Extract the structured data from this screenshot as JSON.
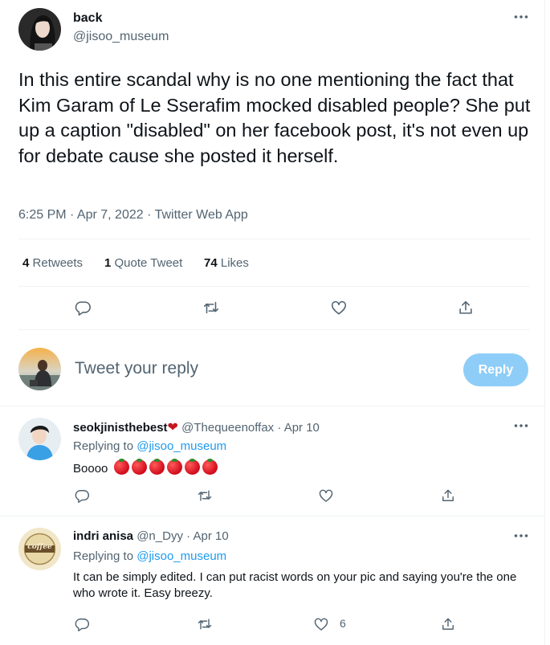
{
  "main_tweet": {
    "display_name": "back",
    "handle": "@jisoo_museum",
    "text": "In this entire scandal why is no one mentioning the fact that Kim Garam of Le Sserafim mocked disabled people? She put up a caption \"disabled\" on her facebook post, it's not even up for debate cause she posted it herself.",
    "timestamp": "6:25 PM · Apr 7, 2022 · Twitter Web App",
    "stats": {
      "retweets_count": "4",
      "retweets_label": "Retweets",
      "quotes_count": "1",
      "quotes_label": "Quote Tweet",
      "likes_count": "74",
      "likes_label": "Likes"
    }
  },
  "reply_box": {
    "placeholder": "Tweet your reply",
    "button_label": "Reply"
  },
  "replies": [
    {
      "display_name": "seokjinisthebest",
      "name_emoji": "❤",
      "handle": "@Thequeenoffax",
      "date": "Apr 10",
      "replying_prefix": "Replying to",
      "replying_handle": "@jisoo_museum",
      "text": "Boooo",
      "emoji_count": 6,
      "like_count": ""
    },
    {
      "display_name": "indri anisa",
      "handle": "@n_Dyy",
      "date": "Apr 10",
      "replying_prefix": "Replying to",
      "replying_handle": "@jisoo_museum",
      "text": "It can be simply edited. I can put racist words on your pic and saying you're the one who wrote it. Easy breezy.",
      "avatar_text": "coffee",
      "like_count": "6"
    }
  ],
  "colors": {
    "accent": "#1d9bf0",
    "reply_button_disabled": "#8ecdf8",
    "muted_text": "#536471",
    "divider": "#eff3f4",
    "heart_emoji": "#c4161c"
  },
  "icons": {
    "more": "more-dots-icon",
    "reply": "reply-bubble-icon",
    "retweet": "retweet-icon",
    "like": "heart-icon",
    "share": "share-icon"
  }
}
